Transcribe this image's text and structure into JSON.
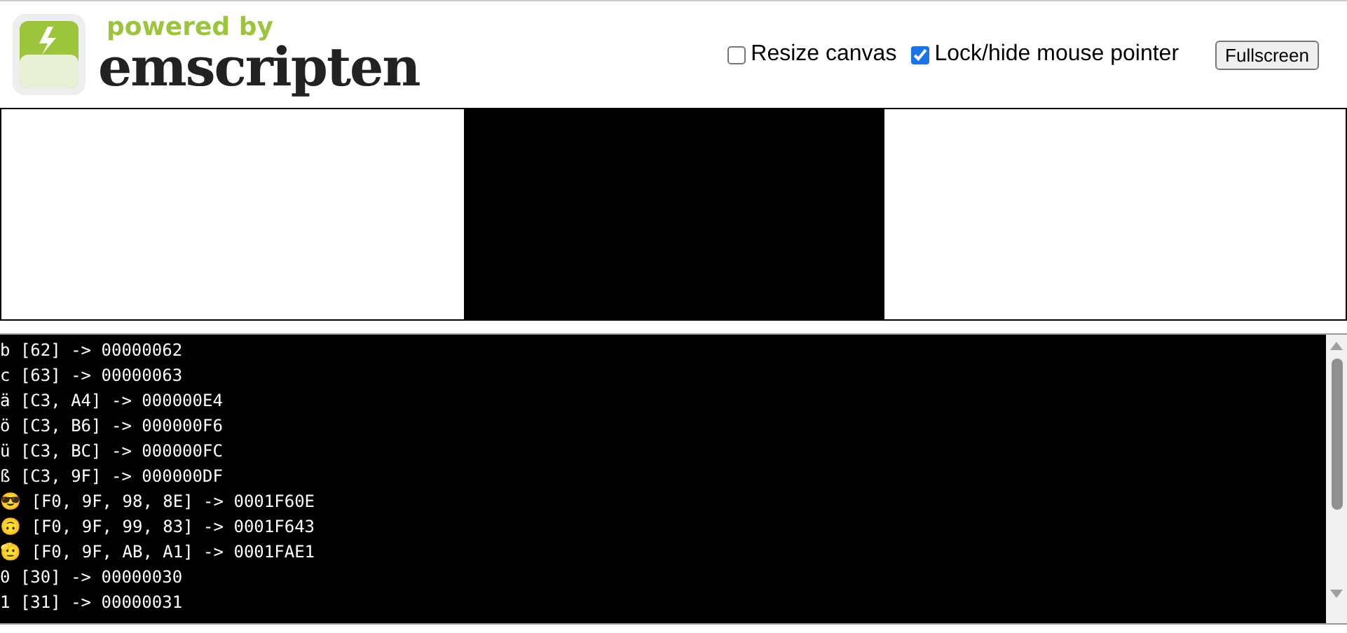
{
  "logo": {
    "tagline": "powered by",
    "name": "emscripten"
  },
  "controls": [
    {
      "label": "Resize canvas",
      "checked": false
    },
    {
      "label": "Lock/hide mouse pointer",
      "checked": true
    }
  ],
  "fullscreen_button": "Fullscreen",
  "output_lines": [
    "b [62] -> 00000062",
    "c [63] -> 00000063",
    "ä [C3, A4] -> 000000E4",
    "ö [C3, B6] -> 000000F6",
    "ü [C3, BC] -> 000000FC",
    "ß [C3, 9F] -> 000000DF",
    "😎 [F0, 9F, 98, 8E] -> 0001F60E",
    "🙃 [F0, 9F, 99, 83] -> 0001F643",
    "🫡 [F0, 9F, AB, A1] -> 0001FAE1",
    "0 [30] -> 00000030",
    "1 [31] -> 00000031"
  ]
}
